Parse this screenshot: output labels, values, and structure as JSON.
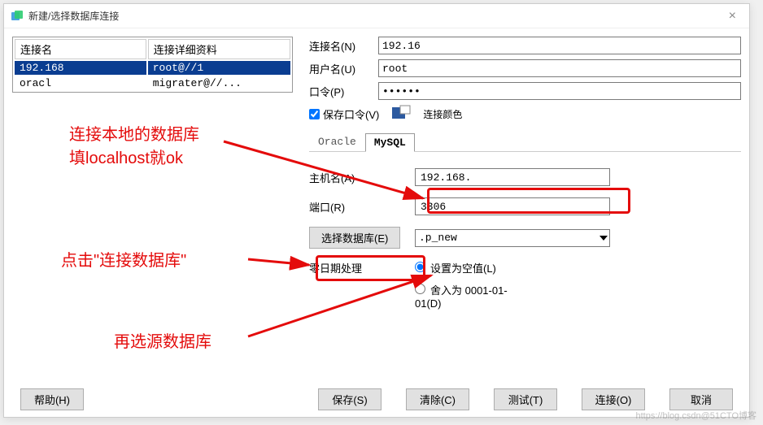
{
  "window": {
    "title": "新建/选择数据库连接"
  },
  "conn_table": {
    "headers": [
      "连接名",
      "连接详细资料"
    ],
    "rows": [
      {
        "name": "192.168",
        "detail": "root@//1"
      },
      {
        "name": "oracl",
        "detail": "migrater@//..."
      }
    ]
  },
  "form": {
    "conn_name_label": "连接名(N)",
    "conn_name_value": "192.16",
    "username_label": "用户名(U)",
    "username_value": "root",
    "password_label": "口令(P)",
    "password_value": "••••••",
    "save_pw_label": "保存口令(V)",
    "save_pw_checked": true,
    "color_label": "连接颜色"
  },
  "tabs": {
    "oracle": "Oracle",
    "mysql": "MySQL"
  },
  "panel": {
    "host_label": "主机名(A)",
    "host_value": "192.168.",
    "port_label": "端口(R)",
    "port_value": "3306",
    "select_db_btn": "选择数据库(E)",
    "db_value": "   .p_new",
    "zero_date_label": "零日期处理",
    "radio_null": "设置为空值(L)",
    "radio_round": "舍入为 0001-01-01(D)"
  },
  "footer": {
    "help": "帮助(H)",
    "save": "保存(S)",
    "clear": "清除(C)",
    "test": "测试(T)",
    "connect": "连接(O)",
    "cancel": "取消"
  },
  "annotations": {
    "a1_line1": "连接本地的数据库",
    "a1_line2": "填localhost就ok",
    "a2": "点击\"连接数据库\"",
    "a3": "再选源数据库"
  },
  "watermark": "https://blog.csdn@51CTO博客"
}
